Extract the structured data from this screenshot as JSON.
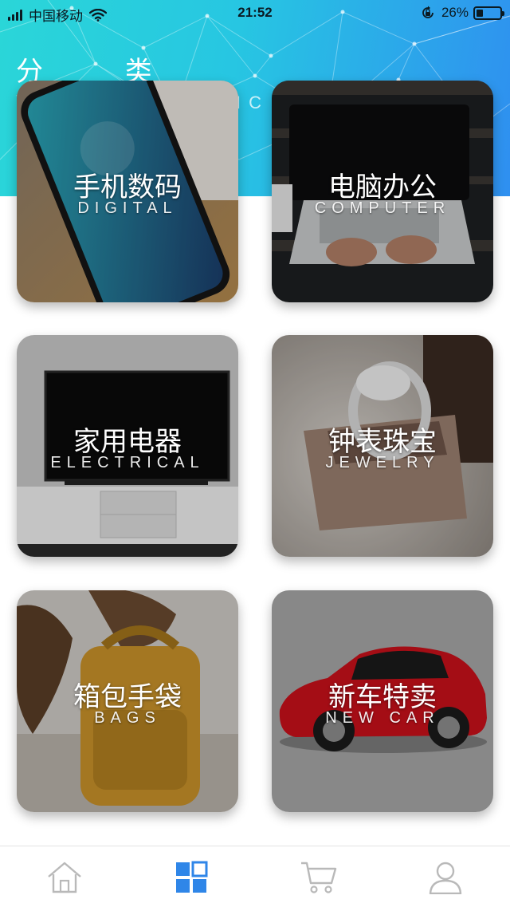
{
  "status_bar": {
    "carrier": "中国移动",
    "time": "21:52",
    "battery": "26%",
    "icons": [
      "signal-icon",
      "wifi-icon",
      "rotation-lock-icon",
      "battery-icon"
    ]
  },
  "header": {
    "title": "分 类",
    "subtitle": "IC"
  },
  "categories": [
    {
      "name": "手机数码",
      "english": "DIGITAL"
    },
    {
      "name": "电脑办公",
      "english": "COMPUTER"
    },
    {
      "name": "家用电器",
      "english": "ELECTRICAL"
    },
    {
      "name": "钟表珠宝",
      "english": "JEWELRY"
    },
    {
      "name": "箱包手袋",
      "english": "BAGS"
    },
    {
      "name": "新车特卖",
      "english": "NEW CAR"
    }
  ],
  "tabbar": {
    "items": [
      {
        "icon": "home-icon",
        "active": false
      },
      {
        "icon": "category-icon",
        "active": true
      },
      {
        "icon": "cart-icon",
        "active": false
      },
      {
        "icon": "profile-icon",
        "active": false
      }
    ],
    "active_color": "#2f86e8",
    "inactive_color": "#b9b9b9"
  },
  "colors": {
    "header_gradient_start": "#2ad6d8",
    "header_gradient_end": "#2f8ff0"
  }
}
